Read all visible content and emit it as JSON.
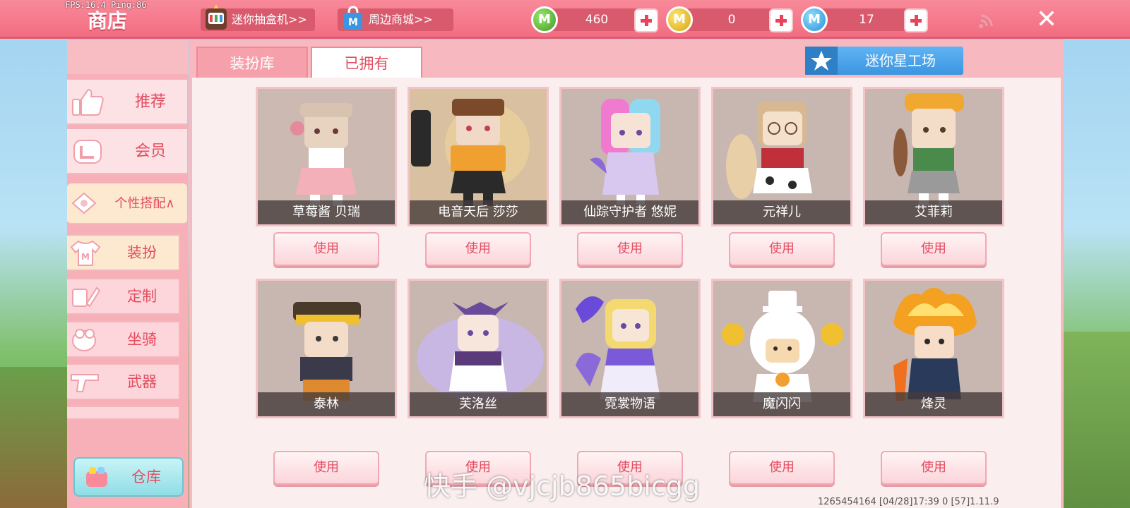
{
  "debug": {
    "fps_text": "FPS:16.4  Ping:86"
  },
  "topbar": {
    "title": "商店",
    "gachabox_label": "迷你抽盒机>>",
    "mall_label": "周边商城>>",
    "currencies": [
      {
        "icon": "green-gem-icon",
        "value": "460",
        "color": "#3f9a2a"
      },
      {
        "icon": "gold-coin-icon",
        "value": "0",
        "color": "#d9a313"
      },
      {
        "icon": "blue-coin-icon",
        "value": "17",
        "color": "#2a8fd6"
      }
    ],
    "coin_letter": "M",
    "close_label": "✕",
    "signal_icon": "signal-icon"
  },
  "sidebar": {
    "items": [
      {
        "label": "推荐",
        "icon": "thumbs-up-icon"
      },
      {
        "label": "会员",
        "icon": "vip-icon"
      },
      {
        "label": "个性搭配∧",
        "icon": "fashion-icon"
      }
    ],
    "subitems": [
      {
        "label": "装扮",
        "icon": "shirt-icon"
      },
      {
        "label": "定制",
        "icon": "brush-icon"
      },
      {
        "label": "坐骑",
        "icon": "mount-icon"
      },
      {
        "label": "武器",
        "icon": "gun-icon"
      }
    ],
    "warehouse_label": "仓库"
  },
  "tabs": {
    "library": "装扮库",
    "owned": "已拥有"
  },
  "workshop_label": "迷你星工场",
  "skins": [
    {
      "name": "草莓酱 贝瑞",
      "button": "使用"
    },
    {
      "name": "电音天后 莎莎",
      "button": "使用"
    },
    {
      "name": "仙踪守护者 悠妮",
      "button": "使用"
    },
    {
      "name": "元祥儿",
      "button": "使用"
    },
    {
      "name": "艾菲莉",
      "button": "使用"
    },
    {
      "name": "泰林",
      "button": "使用"
    },
    {
      "name": "芙洛丝",
      "button": "使用"
    },
    {
      "name": "霓裳物语",
      "button": "使用"
    },
    {
      "name": "魔闪闪",
      "button": "使用"
    },
    {
      "name": "烽灵",
      "button": "使用"
    }
  ],
  "watermark": "快手 @vjcjb865bicgg",
  "footer": "1265454164    [04/28]17:39 0   [57]1.11.9",
  "colors": {
    "brand_pink": "#f26d81",
    "accent_blue": "#3b95e0",
    "text_red": "#e44c60"
  }
}
